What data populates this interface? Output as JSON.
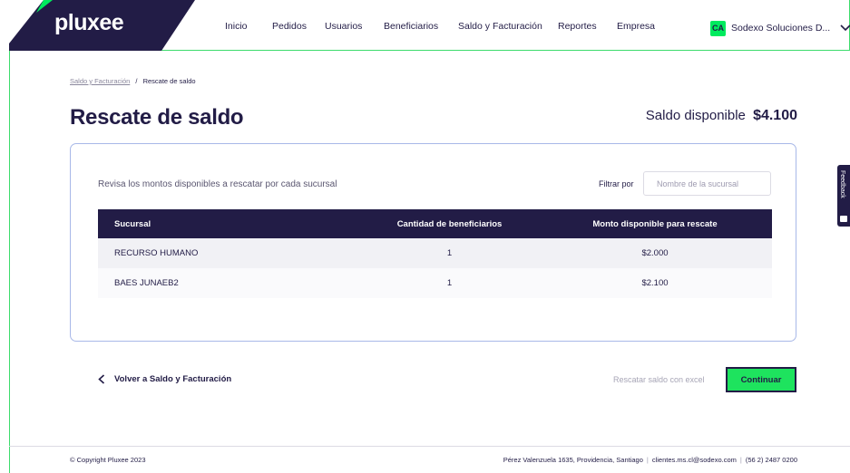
{
  "header": {
    "logo": "pluxee",
    "nav": [
      "Inicio",
      "Pedidos",
      "Usuarios",
      "Beneficiarios",
      "Saldo y Facturación",
      "Reportes",
      "Empresa"
    ],
    "account_initials": "CA",
    "account_name": "Sodexo Soluciones D...",
    "brand_colors": {
      "primary": "#221c46",
      "accent": "#00eb5e"
    }
  },
  "breadcrumb": {
    "parent": "Saldo y Facturación",
    "separator": "/",
    "current": "Rescate de saldo"
  },
  "page_title": "Rescate de saldo",
  "balance": {
    "label": "Saldo disponible",
    "amount": "$4.100"
  },
  "card": {
    "description": "Revisa los montos disponibles a rescatar por cada sucursal",
    "filter_label": "Filtrar por",
    "filter_placeholder": "Nombre de la sucursal",
    "table": {
      "headers": [
        "Sucursal",
        "Cantidad de beneficiarios",
        "Monto disponible para rescate"
      ],
      "rows": [
        [
          "RECURSO HUMANO",
          "1",
          "$2.000"
        ],
        [
          "BAES JUNAEB2",
          "1",
          "$2.100"
        ]
      ]
    }
  },
  "actions": {
    "back_label": "Volver a Saldo y Facturación",
    "excel_label": "Rescatar saldo con excel",
    "continue_label": "Continuar"
  },
  "footer": {
    "copyright": "© Copyright Pluxee 2023",
    "address": "Pérez Valenzuela 1635, Providencia, Santiago",
    "email": "clientes.ms.cl@sodexo.com",
    "phone": "(56 2) 2487 0200"
  },
  "feedback": {
    "label": "Feedback",
    "icon": "mail-icon"
  }
}
